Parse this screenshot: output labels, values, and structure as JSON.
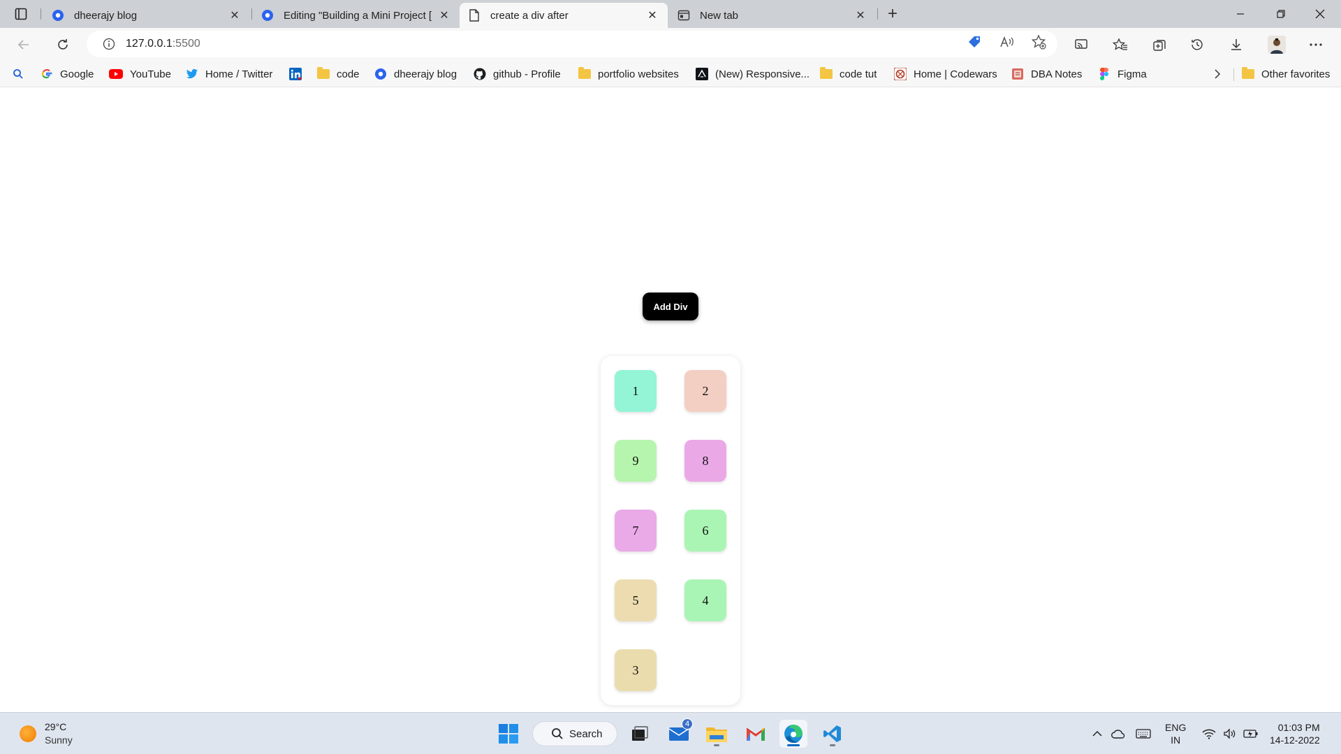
{
  "browser": {
    "tabs": [
      {
        "title": "dheerajy blog",
        "active": false
      },
      {
        "title": "Editing \"Building a Mini Project [",
        "active": false
      },
      {
        "title": "create a div after",
        "active": true
      },
      {
        "title": "New tab",
        "active": false
      }
    ],
    "address": {
      "host": "127.0.0.1",
      "port": ":5500"
    },
    "favorites": [
      {
        "label": "Google"
      },
      {
        "label": "YouTube"
      },
      {
        "label": "Home / Twitter"
      },
      {
        "label": ""
      },
      {
        "label": "code"
      },
      {
        "label": "dheerajy blog"
      },
      {
        "label": "github - Profile"
      },
      {
        "label": "portfolio websites"
      },
      {
        "label": "(New) Responsive..."
      },
      {
        "label": "code tut"
      },
      {
        "label": "Home | Codewars"
      },
      {
        "label": "DBA Notes"
      },
      {
        "label": "Figma"
      }
    ],
    "other_favorites": "Other favorites"
  },
  "page": {
    "add_button": "Add Div",
    "boxes": [
      {
        "label": "1",
        "color": "#93f5d5"
      },
      {
        "label": "2",
        "color": "#f3cfc3"
      },
      {
        "label": "9",
        "color": "#b6f5ad"
      },
      {
        "label": "8",
        "color": "#eaa9e6"
      },
      {
        "label": "7",
        "color": "#eaaae8"
      },
      {
        "label": "6",
        "color": "#aaf5b4"
      },
      {
        "label": "5",
        "color": "#ecdcaf"
      },
      {
        "label": "4",
        "color": "#a9f5b5"
      },
      {
        "label": "3",
        "color": "#ebdcae"
      }
    ]
  },
  "taskbar": {
    "weather": {
      "temp": "29°C",
      "condition": "Sunny"
    },
    "search_label": "Search",
    "mail_badge": "4",
    "language": {
      "line1": "ENG",
      "line2": "IN"
    },
    "clock": {
      "time": "01:03 PM",
      "date": "14-12-2022"
    }
  },
  "colors": {
    "tabstrip": "#cdd0d4",
    "toolbar": "#f7f7f7",
    "taskbar": "#dfe5ef",
    "edge_blue": "#2b6fe0",
    "accent": "#0067c0"
  }
}
